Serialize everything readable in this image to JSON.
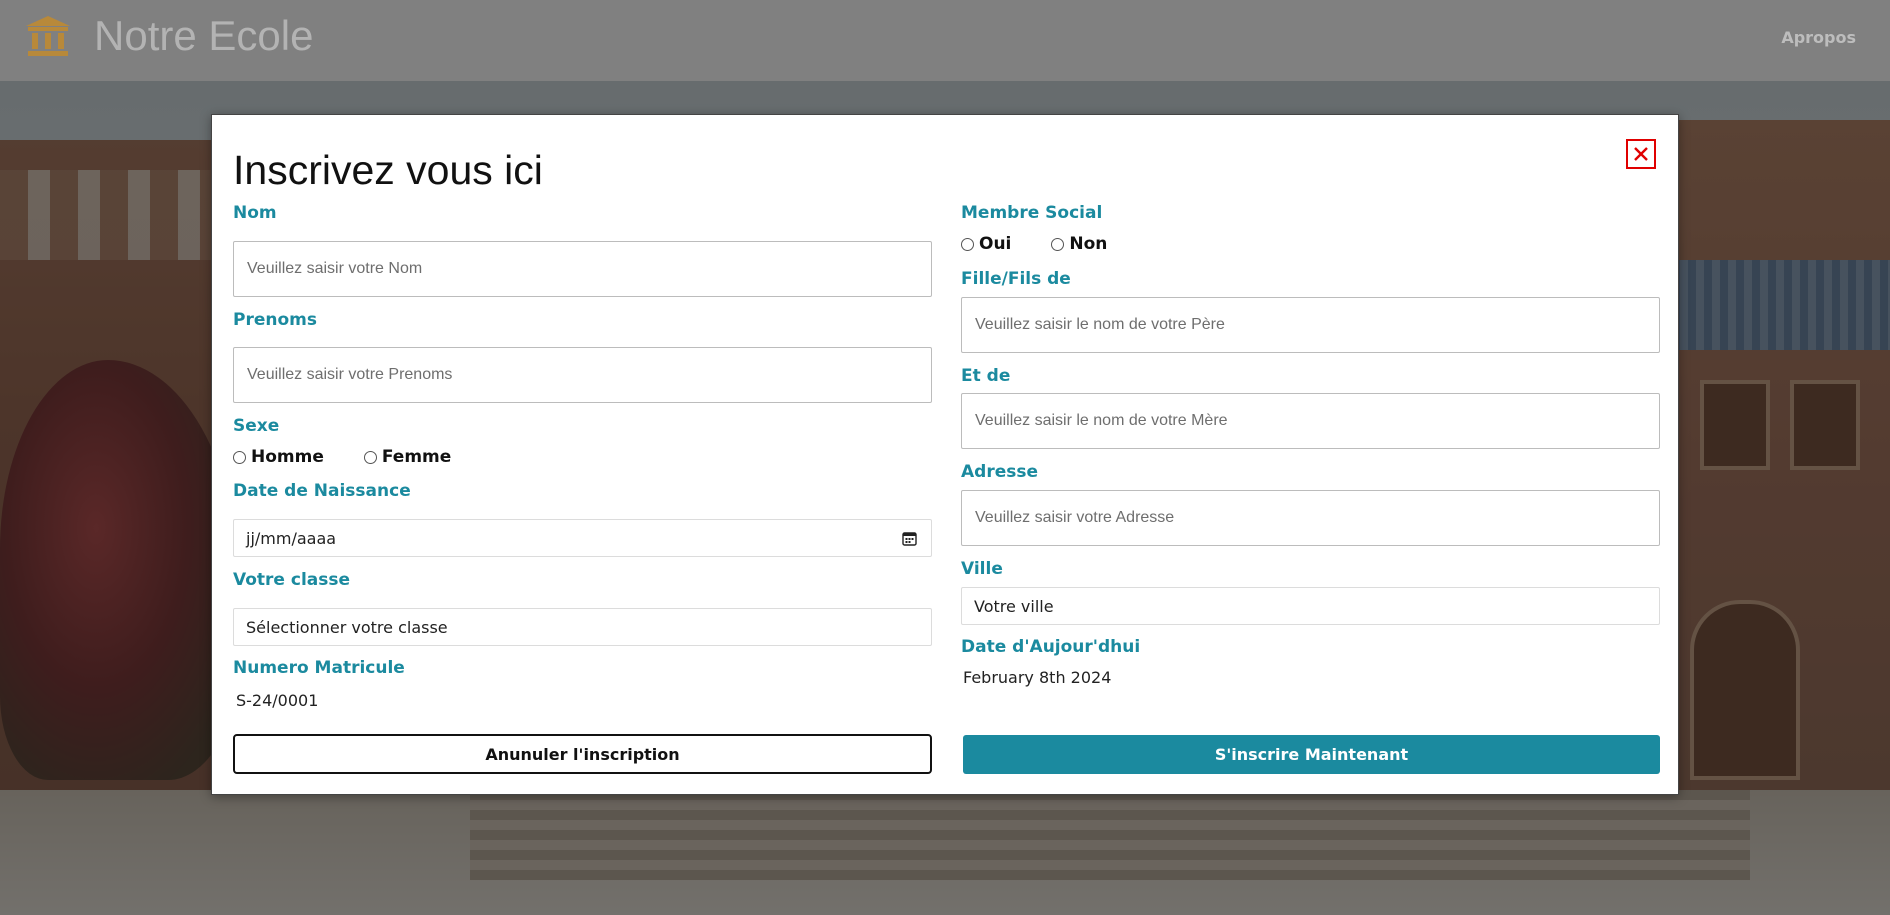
{
  "navbar": {
    "brand": "Notre Ecole",
    "brand_icon": "landmark-icon",
    "link": "Apropos"
  },
  "modal": {
    "title": "Inscrivez vous ici",
    "close_icon": "close-icon",
    "fields": {
      "nom": {
        "label": "Nom",
        "placeholder": "Veuillez saisir votre Nom"
      },
      "prenoms": {
        "label": "Prenoms",
        "placeholder": "Veuillez saisir votre Prenoms"
      },
      "sexe": {
        "label": "Sexe",
        "options": [
          "Homme",
          "Femme"
        ]
      },
      "date_naissance": {
        "label": "Date de Naissance",
        "value": "jj/mm/aaaa"
      },
      "classe": {
        "label": "Votre classe",
        "value": "Sélectionner votre classe"
      },
      "matricule": {
        "label": "Numero Matricule",
        "value": "S-24/0001"
      },
      "membre_social": {
        "label": "Membre Social",
        "options": [
          "Oui",
          "Non"
        ]
      },
      "pere": {
        "label": "Fille/Fils de",
        "placeholder": "Veuillez saisir le nom de votre Père"
      },
      "mere": {
        "label": "Et de",
        "placeholder": "Veuillez saisir le nom de votre Mère"
      },
      "adresse": {
        "label": "Adresse",
        "placeholder": "Veuillez saisir votre Adresse"
      },
      "ville": {
        "label": "Ville",
        "value": "Votre ville"
      },
      "date_jour": {
        "label": "Date d'Aujour'dhui",
        "value": "February 8th 2024"
      }
    },
    "buttons": {
      "cancel": "Anunuler l'inscription",
      "submit": "S'inscrire Maintenant"
    }
  },
  "colors": {
    "accent": "#1b8a9f",
    "close": "#e00000",
    "navbar": "#808080",
    "brand_icon": "#b8893a"
  }
}
